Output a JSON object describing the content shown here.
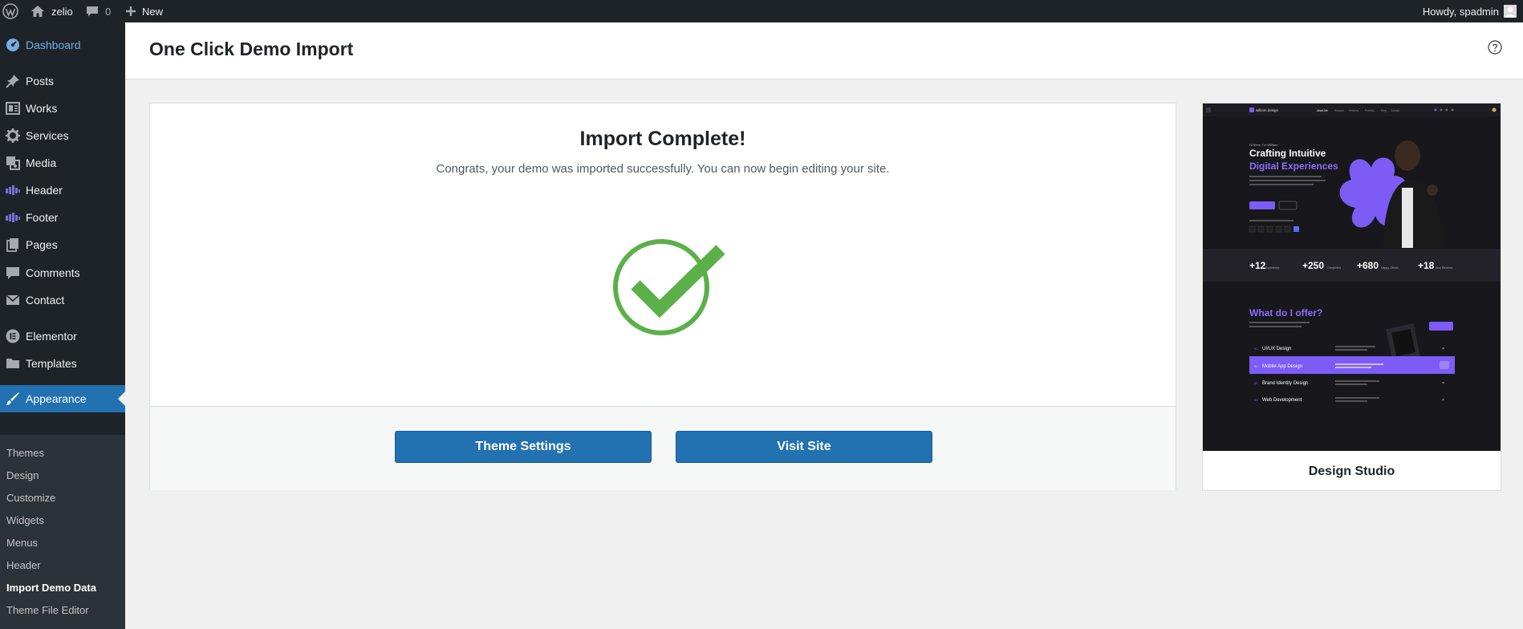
{
  "adminbar": {
    "site_name": "zelio",
    "comments_count": "0",
    "new_label": "New",
    "howdy": "Howdy, spadmin"
  },
  "sidebar": {
    "items": [
      {
        "label": "Dashboard",
        "icon": "dashboard-icon"
      },
      {
        "label": "Posts",
        "icon": "pin-icon"
      },
      {
        "label": "Works",
        "icon": "portfolio-icon"
      },
      {
        "label": "Services",
        "icon": "gear-icon"
      },
      {
        "label": "Media",
        "icon": "media-icon"
      },
      {
        "label": "Header",
        "icon": "elementor-header-icon"
      },
      {
        "label": "Footer",
        "icon": "elementor-footer-icon"
      },
      {
        "label": "Pages",
        "icon": "pages-icon"
      },
      {
        "label": "Comments",
        "icon": "comment-icon"
      },
      {
        "label": "Contact",
        "icon": "mail-icon"
      },
      {
        "label": "Elementor",
        "icon": "elementor-icon"
      },
      {
        "label": "Templates",
        "icon": "folder-icon"
      },
      {
        "label": "Appearance",
        "icon": "brush-icon"
      }
    ],
    "submenu": [
      "Themes",
      "Design",
      "Customize",
      "Widgets",
      "Menus",
      "Header",
      "Import Demo Data",
      "Theme File Editor"
    ]
  },
  "page": {
    "title": "One Click Demo Import",
    "help_icon": "help-icon"
  },
  "import": {
    "title": "Import Complete!",
    "subtitle": "Congrats, your demo was imported successfully. You can now begin editing your site.",
    "status_icon": "check-circle-icon",
    "accent": "#5cb04a",
    "buttons": {
      "theme_settings": "Theme Settings",
      "visit_site": "Visit Site"
    }
  },
  "demo": {
    "name": "Design Studio",
    "preview": {
      "logo": "william.design",
      "nav": [
        "About Me",
        "Resume",
        "Services",
        "Portfolio",
        "Blog",
        "Contact"
      ],
      "greeting": "Hi there, I'm William",
      "headline_1": "Crafting Intuitive",
      "headline_2": "Digital Experiences",
      "stats": [
        {
          "value": "+12",
          "label": "Experience"
        },
        {
          "value": "+250",
          "label": "Completed"
        },
        {
          "value": "+680",
          "label": "Happy Clients"
        },
        {
          "value": "+18",
          "label": "Won Reviews"
        }
      ],
      "section_title": "What do I offer?",
      "services": [
        {
          "num": "01",
          "name": "UI/UX Design"
        },
        {
          "num": "02",
          "name": "Mobile App Design"
        },
        {
          "num": "03",
          "name": "Brand Identity Design"
        },
        {
          "num": "04",
          "name": "Web Development"
        }
      ]
    }
  }
}
